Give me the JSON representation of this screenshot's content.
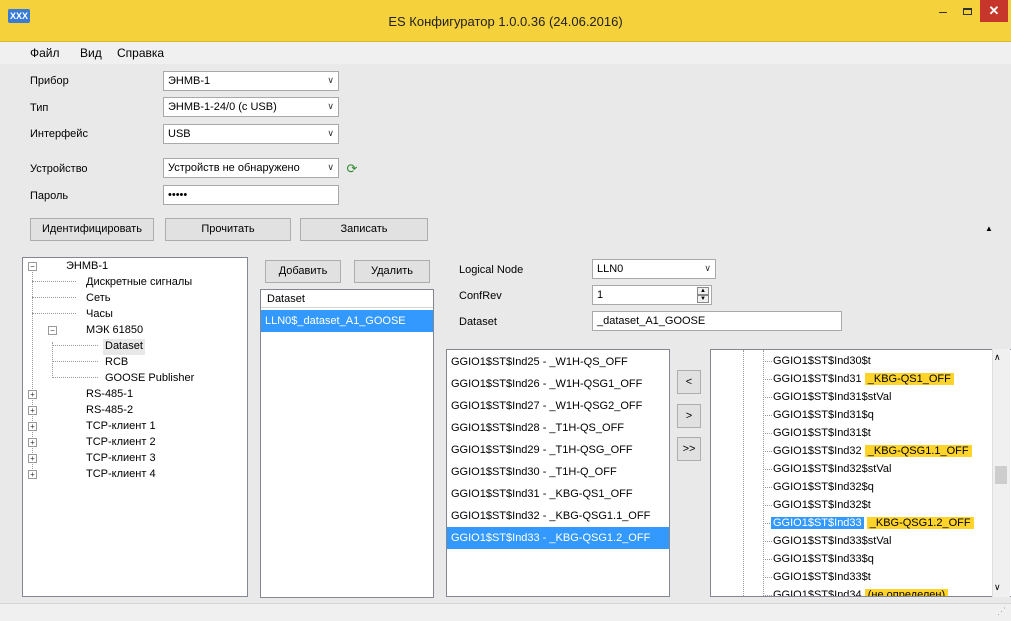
{
  "window": {
    "title": "ES Конфигуратор 1.0.0.36 (24.06.2016)",
    "app_icon_glyph": "XXX",
    "minimize_glyph": "–",
    "close_glyph": "✕"
  },
  "menu": [
    "Файл",
    "Вид",
    "Справка"
  ],
  "form": {
    "device_label": "Прибор",
    "device_value": "ЭНМВ-1",
    "type_label": "Тип",
    "type_value": "ЭНМВ-1-24/0 (с USB)",
    "interface_label": "Интерфейс",
    "interface_value": "USB",
    "unit_label": "Устройство",
    "unit_value": "Устройств не обнаружено",
    "password_label": "Пароль",
    "password_value": "•••••"
  },
  "buttons": {
    "identify": "Идентифицировать",
    "read": "Прочитать",
    "write": "Записать",
    "add": "Добавить",
    "delete": "Удалить",
    "move_left": "<",
    "move_right": ">",
    "move_all_right": ">>"
  },
  "tree": {
    "root": "ЭНМВ-1",
    "items": [
      "Дискретные сигналы",
      "Сеть",
      "Часы",
      "МЭК 61850",
      "Dataset",
      "RCB",
      "GOOSE Publisher",
      "RS-485-1",
      "RS-485-2",
      "TCP-клиент 1",
      "TCP-клиент 2",
      "TCP-клиент 3",
      "TCP-клиент 4"
    ],
    "expand_glyph": "+",
    "collapse_glyph": "−"
  },
  "dataset_list": {
    "header": "Dataset",
    "items": [
      "LLN0$_dataset_A1_GOOSE"
    ]
  },
  "props": {
    "ln_label": "Logical Node",
    "ln_value": "LLN0",
    "confrev_label": "ConfRev",
    "confrev_value": "1",
    "dataset_label": "Dataset",
    "dataset_value": "_dataset_A1_GOOSE"
  },
  "mid_list": [
    "GGIO1$ST$Ind25 - _W1H-QS_OFF",
    "GGIO1$ST$Ind26 - _W1H-QSG1_OFF",
    "GGIO1$ST$Ind27 - _W1H-QSG2_OFF",
    "GGIO1$ST$Ind28 - _T1H-QS_OFF",
    "GGIO1$ST$Ind29 - _T1H-QSG_OFF",
    "GGIO1$ST$Ind30 - _T1H-Q_OFF",
    "GGIO1$ST$Ind31 - _KBG-QS1_OFF",
    "GGIO1$ST$Ind32 - _KBG-QSG1.1_OFF",
    "GGIO1$ST$Ind33 - _KBG-QSG1.2_OFF"
  ],
  "right_tree": [
    {
      "text": "GGIO1$ST$Ind30$t",
      "tag": ""
    },
    {
      "text": "GGIO1$ST$Ind31",
      "tag": "_KBG-QS1_OFF"
    },
    {
      "text": "GGIO1$ST$Ind31$stVal",
      "tag": ""
    },
    {
      "text": "GGIO1$ST$Ind31$q",
      "tag": ""
    },
    {
      "text": "GGIO1$ST$Ind31$t",
      "tag": ""
    },
    {
      "text": "GGIO1$ST$Ind32",
      "tag": "_KBG-QSG1.1_OFF"
    },
    {
      "text": "GGIO1$ST$Ind32$stVal",
      "tag": ""
    },
    {
      "text": "GGIO1$ST$Ind32$q",
      "tag": ""
    },
    {
      "text": "GGIO1$ST$Ind32$t",
      "tag": ""
    },
    {
      "text": "GGIO1$ST$Ind33",
      "tag": "_KBG-QSG1.2_OFF"
    },
    {
      "text": "GGIO1$ST$Ind33$stVal",
      "tag": ""
    },
    {
      "text": "GGIO1$ST$Ind33$q",
      "tag": ""
    },
    {
      "text": "GGIO1$ST$Ind33$t",
      "tag": ""
    },
    {
      "text": "GGIO1$ST$Ind34",
      "tag": "(не определен)"
    }
  ],
  "icons": {
    "combo_arrow": "∨",
    "refresh": "⟳",
    "collapse": "▲",
    "spin_up": "▲",
    "spin_down": "▼",
    "scroll_up": "∧",
    "scroll_down": "∨",
    "grip": "⋰"
  },
  "colors": {
    "titlebar": "#f5d13b",
    "selection": "#3399ff",
    "highlight": "#ffd42a",
    "close": "#c7362b"
  }
}
